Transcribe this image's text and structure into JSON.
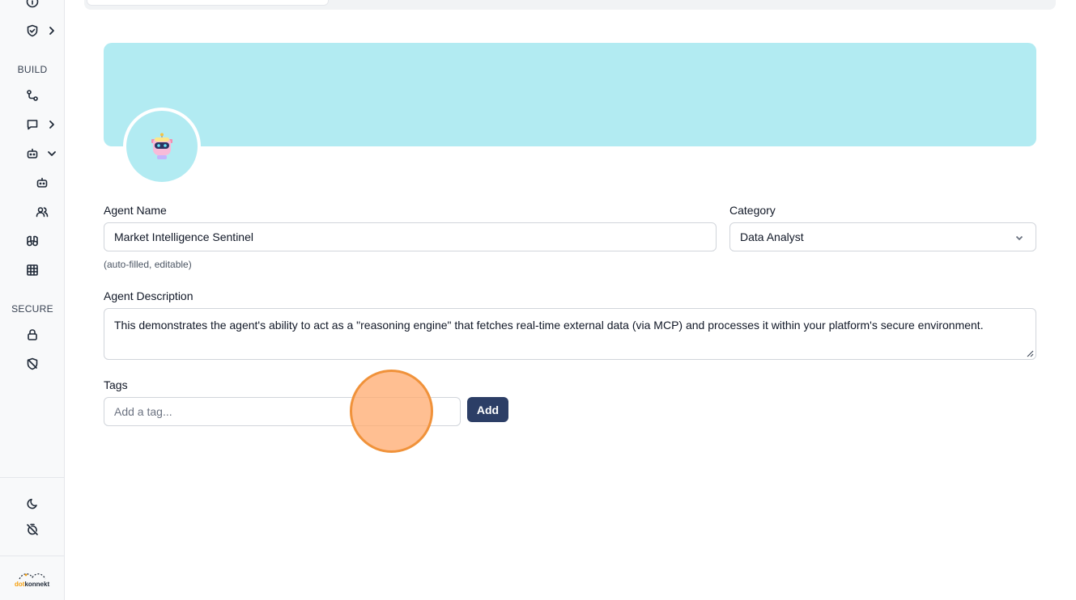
{
  "sidebar": {
    "sections": {
      "build": "BUILD",
      "secure": "SECURE"
    },
    "icons": [
      "info-icon",
      "shield-check-icon",
      "workflow-icon",
      "chat-icon",
      "bot-icon",
      "bot-small-icon",
      "users-icon",
      "binoculars-icon",
      "grid-icon",
      "lock-icon",
      "shield-off-icon",
      "moon-icon",
      "timer-off-icon"
    ],
    "logo": {
      "prefix": "dot",
      "suffix": "konnekt"
    }
  },
  "colors": {
    "banner": "#b2ebf2",
    "primary_button": "#2c3e66",
    "cursor": "#f0923a"
  },
  "form": {
    "agent_name": {
      "label": "Agent Name",
      "value": "Market Intelligence Sentinel",
      "hint": "(auto-filled, editable)"
    },
    "category": {
      "label": "Category",
      "value": "Data Analyst"
    },
    "description": {
      "label": "Agent Description",
      "value": "This demonstrates the agent's ability to act as a \"reasoning engine\" that fetches real-time external data (via MCP) and processes it within your platform's secure environment."
    },
    "tags": {
      "label": "Tags",
      "placeholder": "Add a tag...",
      "add_label": "Add"
    }
  }
}
